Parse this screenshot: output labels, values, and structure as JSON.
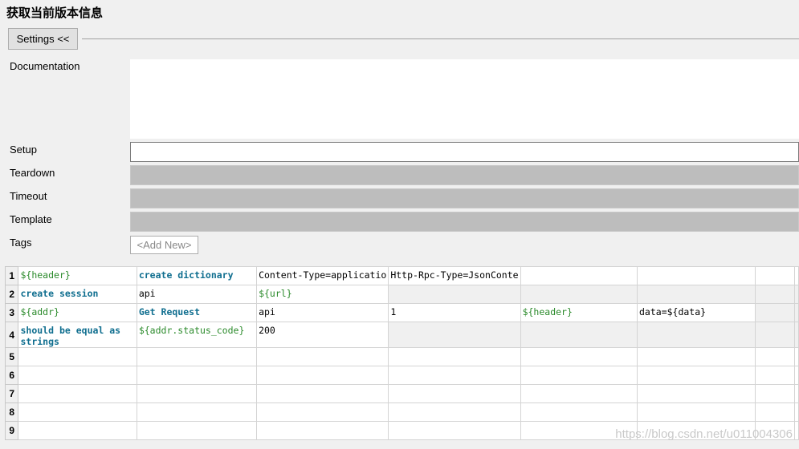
{
  "title": "获取当前版本信息",
  "settings_button": "Settings <<",
  "labels": {
    "documentation": "Documentation",
    "setup": "Setup",
    "teardown": "Teardown",
    "timeout": "Timeout",
    "template": "Template",
    "tags": "Tags"
  },
  "add_new": "<Add New>",
  "grid": {
    "row_numbers": [
      "1",
      "2",
      "3",
      "4",
      "5",
      "6",
      "7",
      "8",
      "9"
    ],
    "rows": [
      [
        {
          "text": "${header}",
          "kind": "var"
        },
        {
          "text": "create dictionary",
          "kind": "kw"
        },
        {
          "text": "Content-Type=applicatio",
          "kind": "plain"
        },
        {
          "text": "Http-Rpc-Type=JsonConte",
          "kind": "plain"
        },
        {
          "text": "",
          "kind": "plain"
        },
        {
          "text": "",
          "kind": "plain"
        },
        {
          "text": "",
          "kind": "plain"
        }
      ],
      [
        {
          "text": "create session",
          "kind": "kw"
        },
        {
          "text": "api",
          "kind": "plain"
        },
        {
          "text": "${url}",
          "kind": "var"
        },
        {
          "text": "",
          "kind": "empty"
        },
        {
          "text": "",
          "kind": "empty"
        },
        {
          "text": "",
          "kind": "empty"
        },
        {
          "text": "",
          "kind": "empty"
        }
      ],
      [
        {
          "text": "${addr}",
          "kind": "var"
        },
        {
          "text": "Get Request",
          "kind": "kw"
        },
        {
          "text": "api",
          "kind": "plain"
        },
        {
          "text": "1",
          "kind": "plain"
        },
        {
          "text": "${header}",
          "kind": "var"
        },
        {
          "text": "data=${data}",
          "kind": "plain"
        },
        {
          "text": "",
          "kind": "empty"
        }
      ],
      [
        {
          "text": "should be equal as strings",
          "kind": "kw-wrap"
        },
        {
          "text": "${addr.status_code}",
          "kind": "var"
        },
        {
          "text": "200",
          "kind": "plain"
        },
        {
          "text": "",
          "kind": "empty"
        },
        {
          "text": "",
          "kind": "empty"
        },
        {
          "text": "",
          "kind": "empty"
        },
        {
          "text": "",
          "kind": "empty"
        }
      ]
    ],
    "empty_rows": 5,
    "columns": 7
  },
  "watermark": "https://blog.csdn.net/u011004306"
}
